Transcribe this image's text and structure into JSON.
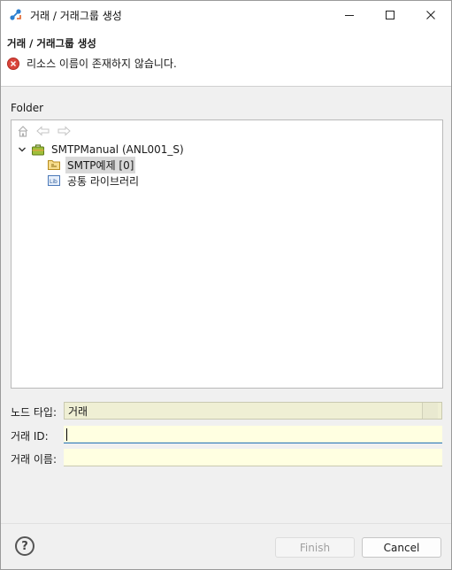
{
  "window": {
    "title": "거래 / 거래그룹 생성",
    "minimize_icon": "minimize-icon",
    "maximize_icon": "maximize-icon",
    "close_icon": "close-icon"
  },
  "header": {
    "wizard_title": "거래 / 거래그룹 생성",
    "error_message": "리소스 이름이 존재하지 않습니다.",
    "error_icon": "error-icon",
    "error_color": "#d9453c"
  },
  "folder": {
    "label": "Folder",
    "toolbar": [
      "home-icon",
      "back-icon",
      "forward-icon"
    ],
    "tree": {
      "root": {
        "label": "SMTPManual  (ANL001_S)",
        "icon": "project-icon",
        "expanded": true
      },
      "children": [
        {
          "label": "SMTP예제 [0]",
          "icon": "folder-icon",
          "selected": true
        },
        {
          "label": "공통 라이브러리",
          "icon": "library-icon",
          "selected": false
        }
      ]
    }
  },
  "fields": {
    "node_type_label": "노드 타입:",
    "node_type_value": "거래",
    "transaction_id_label": "거래 ID:",
    "transaction_id_value": "",
    "transaction_name_label": "거래 이름:",
    "transaction_name_value": ""
  },
  "footer": {
    "help_icon": "help-icon",
    "finish_label": "Finish",
    "cancel_label": "Cancel"
  }
}
